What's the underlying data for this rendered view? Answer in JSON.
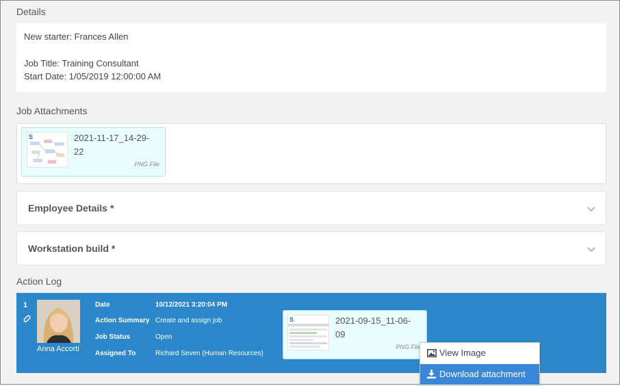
{
  "details": {
    "title": "Details",
    "line1": "New starter:  Frances Allen",
    "line2": "Job Title: Training Consultant",
    "line3": "Start Date: 1/05/2019 12:00:00 AM"
  },
  "job_attachments": {
    "title": "Job Attachments",
    "file": {
      "name_line1": "2021-11-17_14-29-",
      "name_line2": "22",
      "type": "PNG File"
    }
  },
  "accordions": [
    {
      "label": "Employee Details *"
    },
    {
      "label": "Workstation build *"
    }
  ],
  "action_log": {
    "title": "Action Log",
    "entry": {
      "number": "1",
      "user_name": "Anna Accorti",
      "fields": [
        {
          "label": "Date",
          "value": "10/12/2021 3:20:04 PM"
        },
        {
          "label": "Action Summary",
          "value": "Create and assign job"
        },
        {
          "label": "Job Status",
          "value": "Open"
        },
        {
          "label": "Assigned To",
          "value": "Richard Seven (Human Resources)"
        }
      ],
      "attachment": {
        "name_line1": "2021-09-15_11-06-",
        "name_line2": "09",
        "type": "PNG File"
      }
    }
  },
  "context_menu": {
    "items": [
      {
        "label": "View Image",
        "icon": "image-icon"
      },
      {
        "label": "Download attachment",
        "icon": "download-icon"
      }
    ]
  },
  "colors": {
    "log_bg": "#2b87c9",
    "highlight": "#3a87d6",
    "tile_bg": "#e8fbfd"
  }
}
